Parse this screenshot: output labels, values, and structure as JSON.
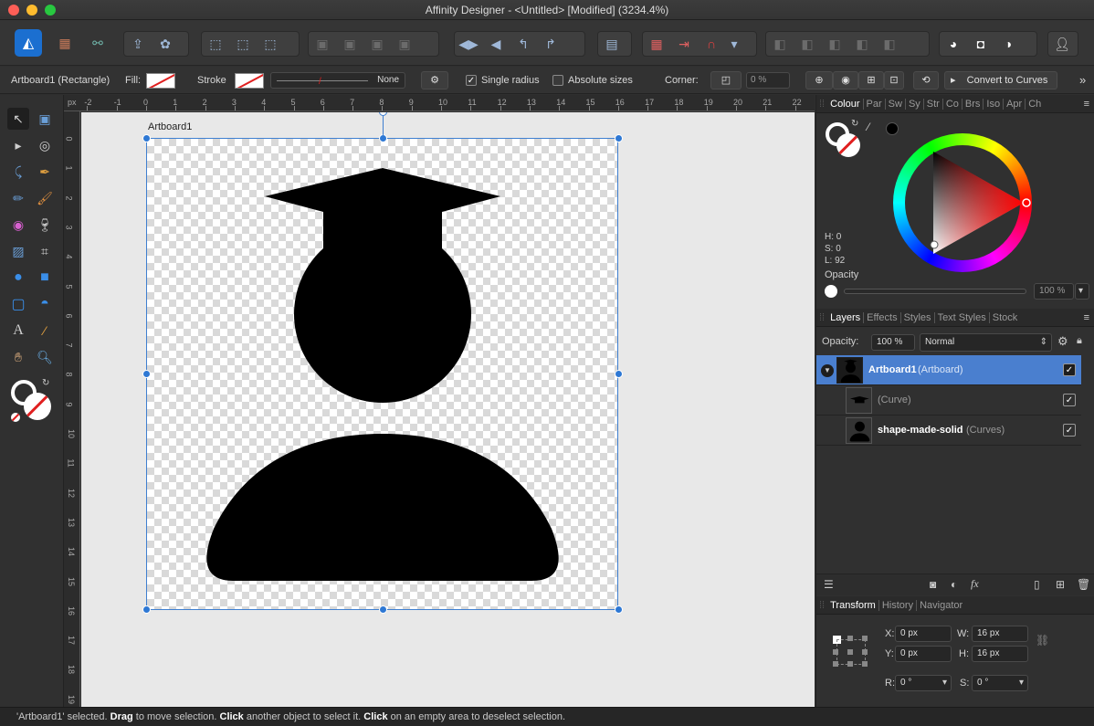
{
  "window": {
    "title": "Affinity Designer - <Untitled> [Modified] (3234.4%)"
  },
  "context_bar": {
    "selection": "Artboard1 (Rectangle)",
    "fill_label": "Fill:",
    "stroke_label": "Stroke",
    "stroke_style": "None",
    "single_radius": "Single radius",
    "absolute_sizes": "Absolute sizes",
    "corner_label": "Corner:",
    "corner_value": "0 %",
    "convert_button": "Convert to Curves"
  },
  "rulers": {
    "unit": "px",
    "h_ticks": [
      "-2",
      "-1",
      "0",
      "1",
      "2",
      "3",
      "4",
      "5",
      "6",
      "7",
      "8",
      "9",
      "10",
      "11",
      "12",
      "13",
      "14",
      "15",
      "16",
      "17",
      "18",
      "19",
      "20",
      "21",
      "22"
    ],
    "v_ticks": [
      "0",
      "1",
      "2",
      "3",
      "4",
      "5",
      "6",
      "7",
      "8",
      "9",
      "10",
      "11",
      "12",
      "13",
      "14",
      "15",
      "16",
      "17",
      "18",
      "19"
    ]
  },
  "canvas": {
    "artboard_label": "Artboard1"
  },
  "colour_panel": {
    "tabs": [
      "Colour",
      "Par",
      "Sw",
      "Sy",
      "Str",
      "Co",
      "Brs",
      "Iso",
      "Apr",
      "Ch"
    ],
    "h": "H: 0",
    "s": "S: 0",
    "l": "L: 92",
    "opacity_label": "Opacity",
    "opacity_value": "100 %"
  },
  "layers_panel": {
    "tabs": [
      "Layers",
      "Effects",
      "Styles",
      "Text Styles",
      "Stock"
    ],
    "opacity_label": "Opacity:",
    "opacity_value": "100 %",
    "blend_mode": "Normal",
    "layers": [
      {
        "name": "Artboard1",
        "type": "(Artboard)"
      },
      {
        "name": "",
        "type": "(Curve)"
      },
      {
        "name": "shape-made-solid",
        "type": "(Curves)"
      }
    ]
  },
  "transform_panel": {
    "tabs": [
      "Transform",
      "History",
      "Navigator"
    ],
    "x_label": "X:",
    "x": "0 px",
    "y_label": "Y:",
    "y": "0 px",
    "w_label": "W:",
    "w": "16 px",
    "h_label": "H:",
    "h": "16 px",
    "r_label": "R:",
    "r": "0 °",
    "s_label": "S:",
    "s": "0 °"
  },
  "status": {
    "part1": "'Artboard1' selected. ",
    "drag": "Drag",
    "part2": " to move selection. ",
    "click1": "Click",
    "part3": " another object to select it. ",
    "click2": "Click",
    "part4": " on an empty area to deselect selection."
  },
  "colors": {
    "accent": "#2e78d4",
    "selection_row": "#4a7fcf",
    "dark_bg": "#303030"
  }
}
